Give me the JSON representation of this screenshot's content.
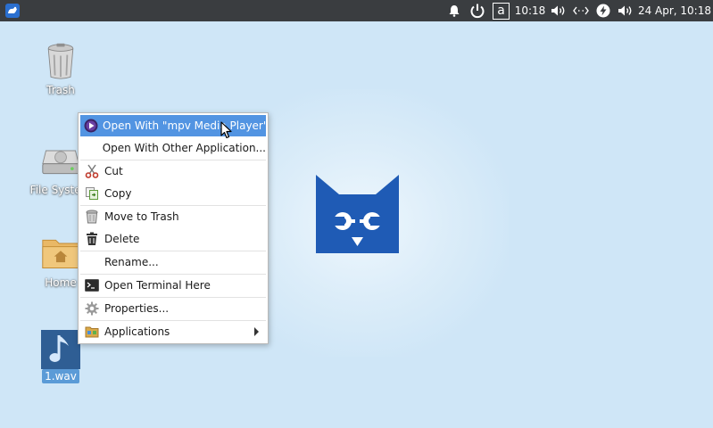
{
  "panel": {
    "clock": "10:18",
    "date_time": "24 Apr, 10:18",
    "keyboard_layout": "a",
    "icons": [
      "xfce-menu-icon",
      "bell-icon",
      "power-icon",
      "keyboard-icon",
      "volume-icon",
      "network-icon",
      "battery-icon",
      "volume-icon"
    ]
  },
  "desktop": {
    "icons": [
      {
        "label": "Trash",
        "icon": "trash-icon"
      },
      {
        "label": "File System",
        "icon": "drive-icon"
      },
      {
        "label": "Home",
        "icon": "home-folder-icon"
      },
      {
        "label": "1.wav",
        "icon": "music-note-icon",
        "selected": true
      }
    ]
  },
  "context_menu": {
    "items": [
      {
        "label": "Open With \"mpv Media Player\"",
        "icon": "mpv-icon",
        "active": true
      },
      {
        "label": "Open With Other Application...",
        "icon": ""
      },
      {
        "label": "Cut",
        "icon": "scissors-icon"
      },
      {
        "label": "Copy",
        "icon": "copy-icon"
      },
      {
        "label": "Move to Trash",
        "icon": "trash-icon"
      },
      {
        "label": "Delete",
        "icon": "delete-icon"
      },
      {
        "label": "Rename...",
        "icon": ""
      },
      {
        "label": "Open Terminal Here",
        "icon": "terminal-icon"
      },
      {
        "label": "Properties...",
        "icon": "gear-icon"
      },
      {
        "label": "Applications",
        "icon": "applications-icon",
        "submenu": true
      }
    ]
  },
  "colors": {
    "panel_bg": "#3a3d40",
    "desktop_bg": "#cfe6f7",
    "menu_highlight": "#5294e2",
    "logo_blue": "#1f5bb5"
  }
}
